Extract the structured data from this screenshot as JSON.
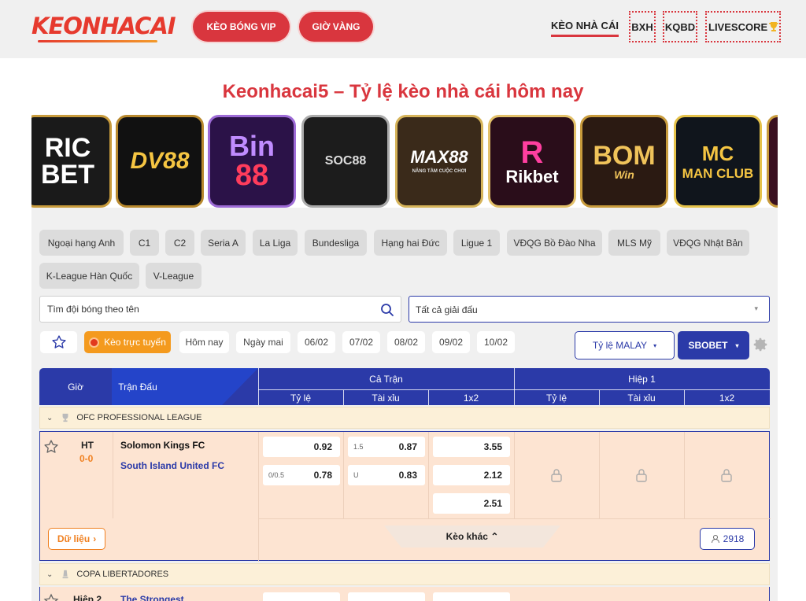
{
  "header": {
    "logo_k": "K",
    "logo_rest": "EONHACAI",
    "vip_button": "KÈO BÓNG VIP",
    "gold_button": "GIỜ VÀNG",
    "nav_active": "KÈO NHÀ CÁI",
    "nav_bxh": "BXH",
    "nav_kqbd": "KQBD",
    "nav_livescore": "LIVESCORE"
  },
  "page_title": "Keonhacai5 – Tỷ lệ kèo nhà cái hôm nay",
  "banners": [
    {
      "line1": "RIC",
      "line2": "BET"
    },
    {
      "line1": "DV88",
      "line2": ""
    },
    {
      "line1": "Bin",
      "line2": "88"
    },
    {
      "line1": "SOC88",
      "line2": ""
    },
    {
      "line1": "MAX88",
      "line2": "NÂNG TẦM CUỘC CHƠI"
    },
    {
      "line1": "R",
      "line2": "Rikbet"
    },
    {
      "line1": "BOM",
      "line2": "Win"
    },
    {
      "line1": "MC",
      "line2": "MAN CLUB"
    }
  ],
  "leagues": [
    "Ngoại hạng Anh",
    "C1",
    "C2",
    "Seria A",
    "La Liga",
    "Bundesliga",
    "Hạng hai Đức",
    "Ligue 1",
    "VĐQG Bồ Đào Nha",
    "MLS Mỹ",
    "VĐQG Nhật Bản",
    "K-League Hàn Quốc",
    "V-League"
  ],
  "search": {
    "placeholder": "Tìm đội bóng theo tên"
  },
  "league_select": {
    "value": "Tất cả giải đấu"
  },
  "filters": {
    "live": "Kèo trực tuyến",
    "today": "Hôm nay",
    "tomorrow": "Ngày mai",
    "dates": [
      "06/02",
      "07/02",
      "08/02",
      "09/02",
      "10/02"
    ],
    "odds_type": "Tỷ lệ MALAY",
    "bookmaker": "SBOBET"
  },
  "table_header": {
    "time": "Giờ",
    "match": "Trận Đấu",
    "full_match": "Cả Trận",
    "first_half": "Hiệp 1",
    "sub": [
      "Tỷ lệ",
      "Tài xỉu",
      "1x2",
      "Tỷ lệ",
      "Tài xỉu",
      "1x2"
    ]
  },
  "league1": {
    "name": "OFC PROFESSIONAL LEAGUE"
  },
  "match1": {
    "status": "HT",
    "score": "0-0",
    "home": "Solomon Kings FC",
    "away": "South Island United FC",
    "handicap": {
      "h1": "",
      "v1": "0.92",
      "h2": "0/0.5",
      "v2": "0.78"
    },
    "overunder": {
      "h1": "1.5",
      "v1": "0.87",
      "h2": "U",
      "v2": "0.83"
    },
    "x12": [
      "3.55",
      "2.12",
      "2.51"
    ],
    "data_button": "Dữ liệu",
    "more_label": "Kèo khác",
    "viewers": "2918"
  },
  "league2": {
    "name": "COPA LIBERTADORES"
  },
  "match2": {
    "status": "Hiệp 2",
    "home": "The Strongest"
  },
  "colors": {
    "brand_red": "#d9363e",
    "brand_blue": "#2b3aa8",
    "accent_orange": "#f08020"
  }
}
